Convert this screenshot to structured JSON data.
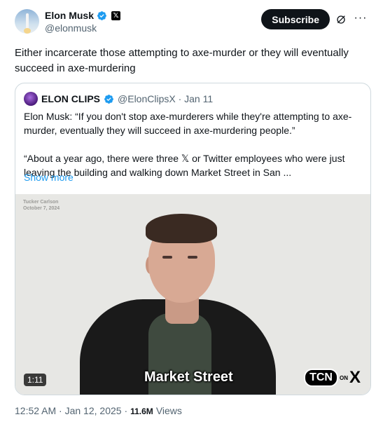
{
  "author": {
    "display_name": "Elon Musk",
    "handle": "@elonmusk",
    "affiliate_badge": "𝕏"
  },
  "actions": {
    "subscribe_label": "Subscribe",
    "more_label": "···"
  },
  "tweet": {
    "text": "Either incarcerate those attempting to axe-murder or they will eventually succeed in axe-murdering"
  },
  "quote": {
    "display_name": "ELON CLIPS",
    "meta": "@ElonClipsX · Jan 11",
    "paragraph_1": "Elon Musk: “If you don't stop axe-murderers while they're attempting to axe-murder, eventually they will succeed in axe-murdering people.”",
    "paragraph_2": "“About a year ago, there were three 𝕏 or Twitter employees who were just leaving the building and walking down Market Street in San  ...",
    "show_more": "Show more"
  },
  "video": {
    "watermark_line_1": "Tucker Carlson",
    "watermark_line_2": "October 7, 2024",
    "caption": "Market Street",
    "duration": "1:11",
    "logo_text": "TCN",
    "logo_on": "ON",
    "logo_x": "X"
  },
  "footer": {
    "timestamp": "12:52 AM · Jan 12, 2025 ·",
    "views_count": "11.6M",
    "views_label": "Views"
  },
  "colors": {
    "accent": "#1d9bf0",
    "text": "#0f1419",
    "secondary": "#536471",
    "border": "#cfd9de"
  }
}
